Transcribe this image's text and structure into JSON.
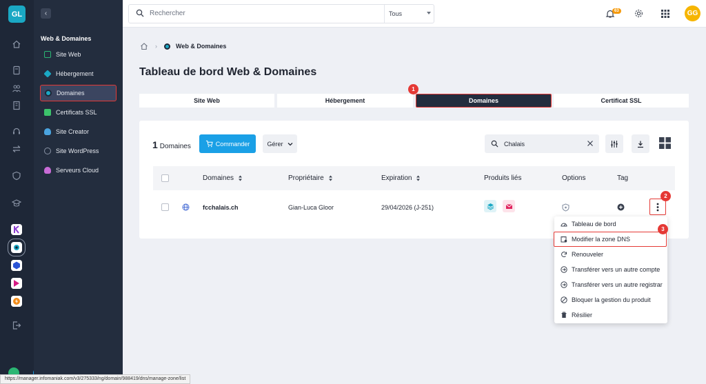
{
  "rail": {
    "logo": "GL"
  },
  "nav": {
    "section": "Web & Domaines",
    "items": [
      {
        "label": "Site Web",
        "color": "#2bb673"
      },
      {
        "label": "Hébergement",
        "color": "#1aa8c4"
      },
      {
        "label": "Domaines",
        "color": "#1aa8c4"
      },
      {
        "label": "Certificats SSL",
        "color": "#3cc36b"
      },
      {
        "label": "Site Creator",
        "color": "#4aa3df"
      },
      {
        "label": "Site WordPress",
        "color": "#8a94a6"
      },
      {
        "label": "Serveurs Cloud",
        "color": "#c86bd6"
      }
    ]
  },
  "topbar": {
    "search_placeholder": "Rechercher",
    "scope": "Tous",
    "notifications": "63",
    "avatar": "GG"
  },
  "breadcrumb": {
    "current": "Web & Domaines"
  },
  "page": {
    "title": "Tableau de bord Web & Domaines"
  },
  "tabs": [
    {
      "label": "Site Web"
    },
    {
      "label": "Hébergement"
    },
    {
      "label": "Domaines"
    },
    {
      "label": "Certificat SSL"
    }
  ],
  "markers": [
    "1",
    "2",
    "3"
  ],
  "card": {
    "count": "1",
    "count_label": "Domaines",
    "order_button": "Commander",
    "manage_button": "Gérer",
    "filter_value": "Chalais"
  },
  "table": {
    "headers": [
      "Domaines",
      "Propriétaire",
      "Expiration",
      "Produits liés",
      "Options",
      "Tag"
    ],
    "rows": [
      {
        "domain": "fcchalais.ch",
        "owner": "Gian-Luca Gloor",
        "expiration": "29/04/2026 (J-251)"
      }
    ]
  },
  "menu": {
    "items": [
      "Tableau de bord",
      "Modifier la zone DNS",
      "Renouveler",
      "Transférer vers un autre compte",
      "Transférer vers un autre registrar",
      "Bloquer la gestion du produit",
      "Résilier"
    ]
  },
  "status_url": "https://manager.infomaniak.com/v3/275333/ng/domain/988419/dns/manage-zone/list",
  "colors": {
    "accent": "#1aa0e6",
    "highlight": "#e53935",
    "dark": "#232d3e"
  }
}
